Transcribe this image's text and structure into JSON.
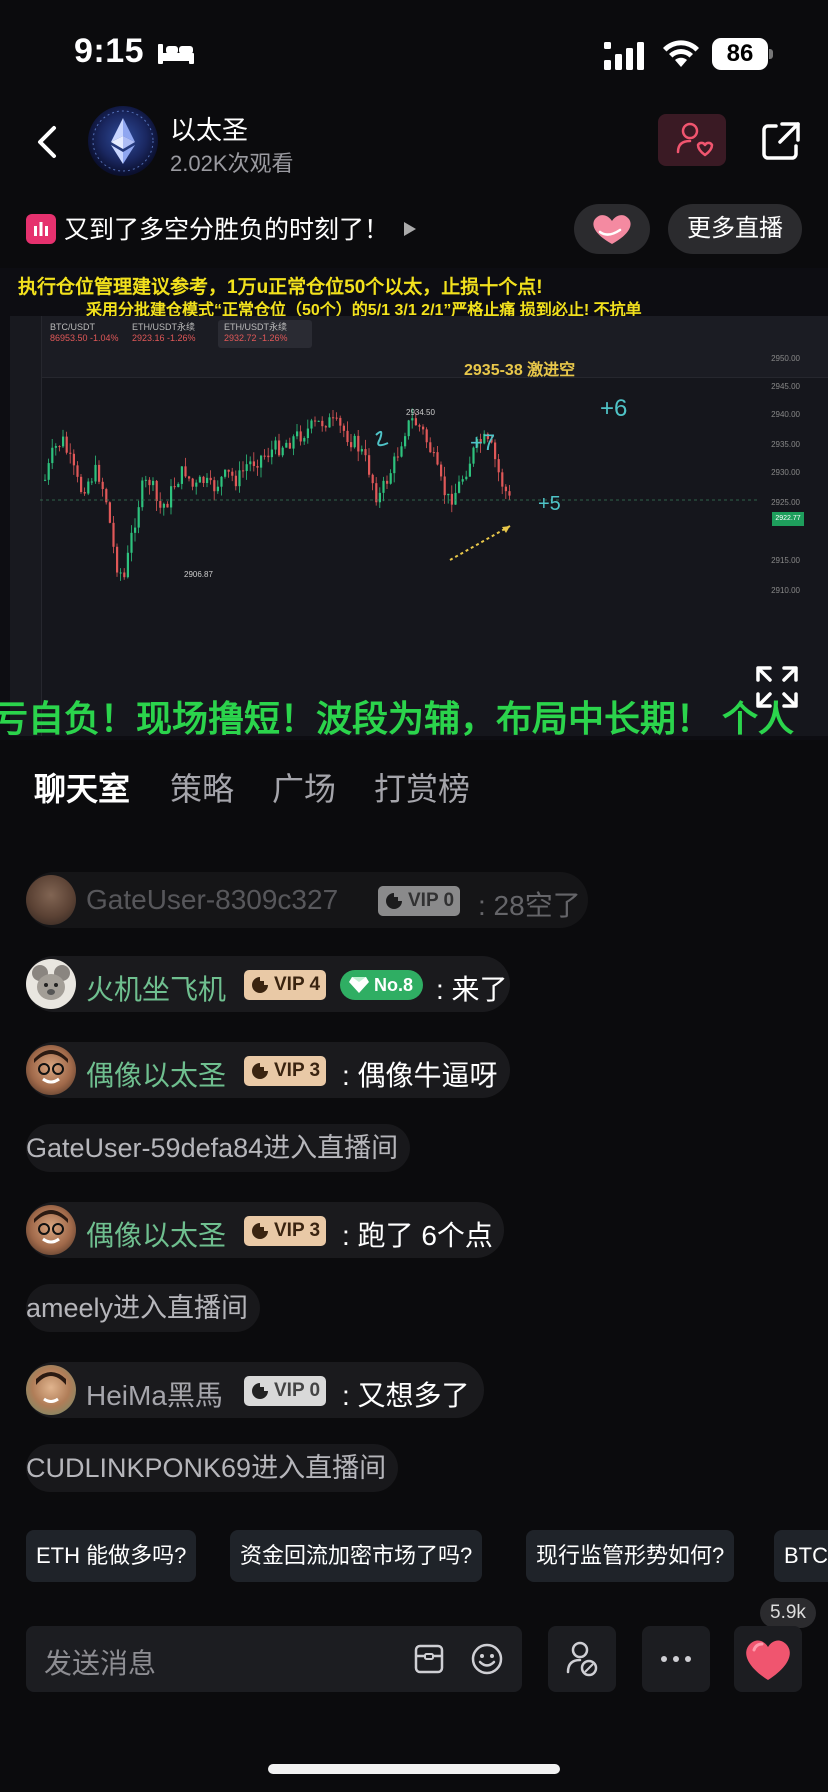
{
  "status_bar": {
    "time": "9:15",
    "battery": "86"
  },
  "header": {
    "channel_name": "以太圣",
    "views": "2.02K次观看"
  },
  "topic": {
    "text": "又到了多空分胜负的时刻了！"
  },
  "more_live_label": "更多直播",
  "video": {
    "banner_line1": "执行仓位管理建议参考，1万u正常仓位50个以太，止损十个点!",
    "banner_line2": "采用分批建仓模式“正常仓位（50个）的5/1   3/1   2/1”严格止痛 损到必止! 不抗单",
    "tickers": [
      {
        "name": "BTC/USDT",
        "value": "86953.50 -1.04%"
      },
      {
        "name": "ETH/USDT永续",
        "value": "2923.16 -1.26%"
      },
      {
        "name": "ETH/USDT永续",
        "value": "2932.72 -1.26%"
      }
    ],
    "annotation": "2935-38 激进空",
    "high_label": "2934.50",
    "low_label": "2906.87",
    "price_tag": "2922.77",
    "axis_ticks": [
      "2950.00",
      "2945.00",
      "2940.00",
      "2935.00",
      "2930.00",
      "2925.00",
      "2915.00",
      "2910.00"
    ],
    "scrolling_text": "亏自负！现场撸短！波段为辅，布局中长期！ 个人"
  },
  "tabs": [
    "聊天室",
    "策略",
    "广场",
    "打赏榜"
  ],
  "chat": {
    "messages": [
      {
        "name": "GateUser-8309c327",
        "vip": "VIP 0",
        "text": ": 28空了"
      },
      {
        "name": "火机坐飞机",
        "vip": "VIP 4",
        "rank": "No.8",
        "text": ": 来了"
      },
      {
        "name": "偶像以太圣",
        "vip": "VIP 3",
        "text": ": 偶像牛逼呀"
      },
      {
        "system": "GateUser-59defa84进入直播间"
      },
      {
        "name": "偶像以太圣",
        "vip": "VIP 3",
        "text": ": 跑了 6个点"
      },
      {
        "system": "ameely进入直播间"
      },
      {
        "name": "HeiMa黑馬",
        "vip": "VIP 0",
        "text": ": 又想多了"
      },
      {
        "system": "CUDLINKPONK69进入直播间"
      }
    ]
  },
  "suggestions": [
    "ETH 能做多吗?",
    "资金回流加密市场了吗?",
    "现行监管形势如何?",
    "BTC"
  ],
  "input": {
    "placeholder": "发送消息"
  },
  "like_count": "5.9k",
  "colors": {
    "accent_green": "#6fbf8f",
    "scroll_green": "#2bd44c",
    "banner_yellow": "#f2e11d",
    "like_red": "#f0556f"
  }
}
